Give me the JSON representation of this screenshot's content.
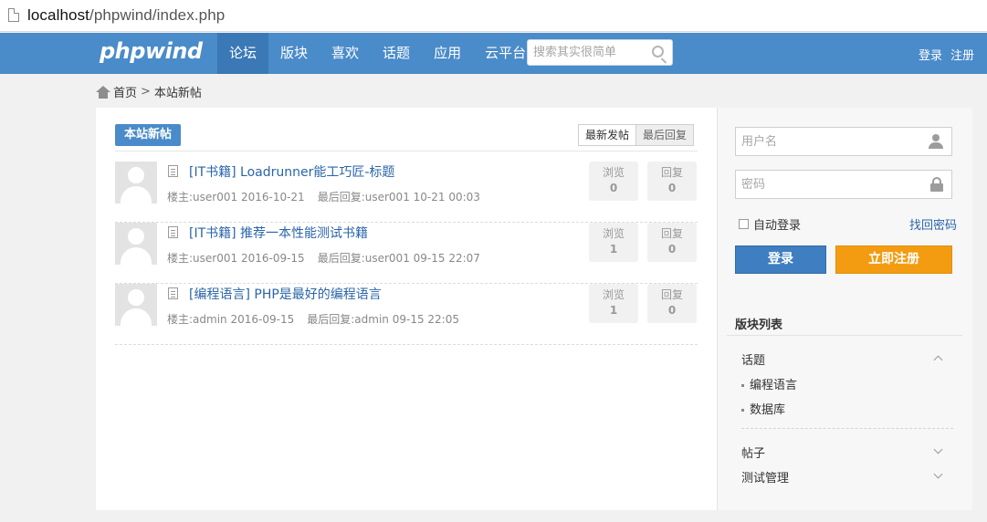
{
  "browser": {
    "url_host": "localhost",
    "url_path": "/phpwind/index.php"
  },
  "header": {
    "logo": "phpwind",
    "nav": [
      "论坛",
      "版块",
      "喜欢",
      "话题",
      "应用",
      "云平台"
    ],
    "search_placeholder": "搜索其实很简单",
    "login": "登录",
    "register": "注册"
  },
  "breadcrumb": {
    "home": "首页",
    "separator": ">",
    "current": "本站新帖"
  },
  "main": {
    "tag": "本站新帖",
    "sort": {
      "latest_post": "最新发帖",
      "latest_reply": "最后回复"
    },
    "threads": [
      {
        "title": "[IT书籍] Loadrunner能工巧匠-标题",
        "owner_label": "楼主:",
        "owner": "user001",
        "date": "2016-10-21",
        "last_label": "最后回复:",
        "last_user": "user001",
        "last_time": "10-21 00:03",
        "views_label": "浏览",
        "views": "0",
        "replies_label": "回复",
        "replies": "0"
      },
      {
        "title": "[IT书籍] 推荐一本性能测试书籍",
        "owner_label": "楼主:",
        "owner": "user001",
        "date": "2016-09-15",
        "last_label": "最后回复:",
        "last_user": "user001",
        "last_time": "09-15 22:07",
        "views_label": "浏览",
        "views": "1",
        "replies_label": "回复",
        "replies": "0"
      },
      {
        "title": "[编程语言] PHP是最好的编程语言",
        "owner_label": "楼主:",
        "owner": "admin",
        "date": "2016-09-15",
        "last_label": "最后回复:",
        "last_user": "admin",
        "last_time": "09-15 22:05",
        "views_label": "浏览",
        "views": "1",
        "replies_label": "回复",
        "replies": "0"
      }
    ]
  },
  "sidebar": {
    "username_placeholder": "用户名",
    "password_placeholder": "密码",
    "remember": "自动登录",
    "forgot": "找回密码",
    "login_button": "登录",
    "register_button": "立即注册",
    "board_list_title": "版块列表",
    "categories": [
      {
        "name": "话题",
        "expanded": true,
        "children": [
          "编程语言",
          "数据库"
        ]
      },
      {
        "name": "帖子",
        "expanded": false
      },
      {
        "name": "测试管理",
        "expanded": false
      }
    ]
  },
  "colors": {
    "header": "#4a8bc9",
    "login_button": "#3f7ec0",
    "register_button": "#f39c12",
    "link": "#2a65a8"
  }
}
